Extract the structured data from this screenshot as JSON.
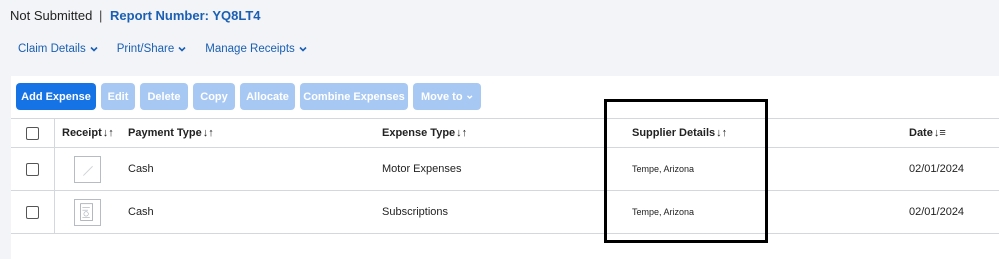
{
  "report": {
    "status": "Not Submitted",
    "separator": "|",
    "report_number": "Report Number: YQ8LT4"
  },
  "menu": {
    "items": [
      {
        "label": "Claim Details",
        "icon": "chevron-down-icon"
      },
      {
        "label": "Print/Share",
        "icon": "chevron-down-icon"
      },
      {
        "label": "Manage Receipts",
        "icon": "chevron-down-icon"
      }
    ]
  },
  "toolbar": {
    "add_expense": "Add Expense",
    "edit": "Edit",
    "delete": "Delete",
    "copy": "Copy",
    "allocate": "Allocate",
    "combine": "Combine Expenses",
    "move_to": "Move to"
  },
  "table": {
    "columns": {
      "receipt": "Receipt",
      "payment_type": "Payment Type",
      "expense_type": "Expense Type",
      "supplier": "Supplier Details",
      "date": "Date"
    },
    "sort_glyph": "↓↑",
    "date_sort_glyph": "↓≡",
    "rows": [
      {
        "payment_type": "Cash",
        "expense_type": "Motor Expenses",
        "supplier": "Tempe, Arizona",
        "date": "02/01/2024"
      },
      {
        "payment_type": "Cash",
        "expense_type": "Subscriptions",
        "supplier": "Tempe, Arizona",
        "date": "02/01/2024"
      }
    ]
  },
  "colors": {
    "accent": "#1673e6",
    "disabled_button": "#a8c8f4",
    "link": "#1a5fb4"
  }
}
